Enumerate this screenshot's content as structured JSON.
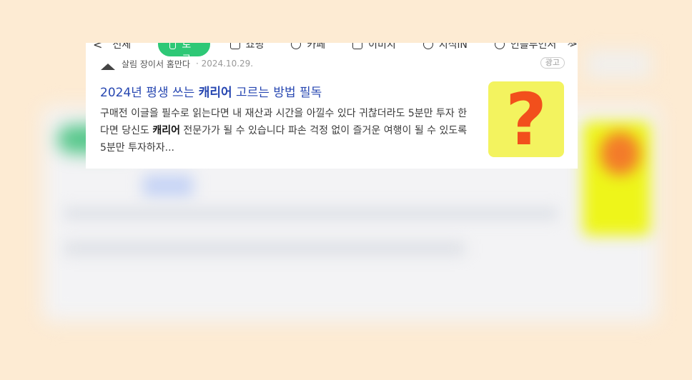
{
  "tabs": {
    "prev": "<",
    "items": [
      {
        "label": "전체",
        "active": false
      },
      {
        "label": "블로그",
        "active": true
      },
      {
        "label": "쇼핑",
        "active": false
      },
      {
        "label": "카페",
        "active": false
      },
      {
        "label": "이미지",
        "active": false
      },
      {
        "label": "지식iN",
        "active": false
      },
      {
        "label": "인플루언서",
        "active": false
      }
    ],
    "next": ">",
    "close": "×"
  },
  "result": {
    "author": "살림 장이서 홈만다",
    "date": "· 2024.10.29.",
    "ad_label": "광고",
    "title_before": "2024년 평생 쓰는 ",
    "title_keyword": "캐리어",
    "title_after": " 고르는 방법 필독",
    "desc_1": "구매전 이글을 필수로 읽는다면 내 재산과 시간을 아낄수 있다 귀찮더라도 5분만 투자 한다면 당신도 ",
    "desc_keyword": "캐리어",
    "desc_2": " 전문가가 될 수 있습니다 파손 걱정 없이 즐거운 여행이 될 수 있도록 5분만 투자하자...",
    "thumbnail_text": "?"
  },
  "colors": {
    "page_bg": "#fdebd3",
    "active_tab": "#2ec876",
    "title_link": "#2747b1",
    "thumb_bg": "#f3f35f",
    "question_mark": "#f24f1c"
  },
  "icons": [
    "blog-icon",
    "shopping-icon",
    "cafe-icon",
    "image-icon",
    "kin-icon",
    "influencer-icon",
    "question-mark-icon"
  ]
}
